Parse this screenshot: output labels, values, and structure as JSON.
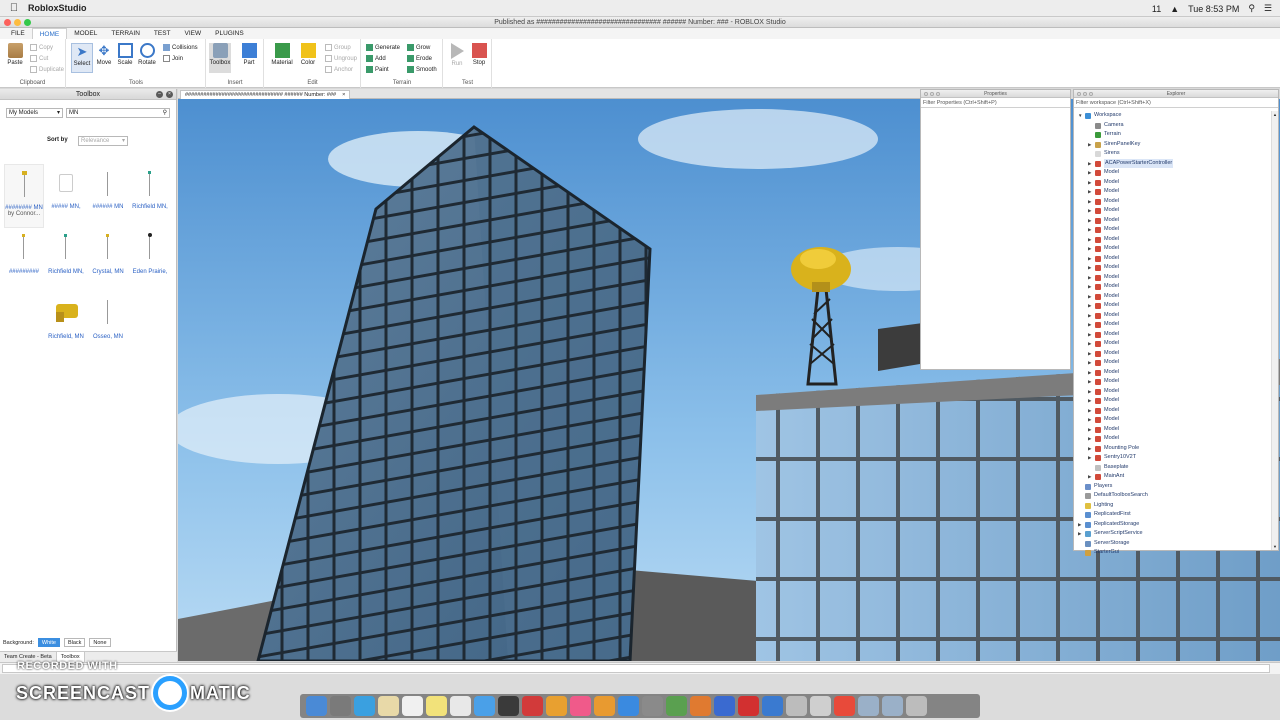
{
  "menubar": {
    "app_name": "RobloxStudio",
    "tray": [
      "11",
      "Tue 8:53 PM"
    ]
  },
  "window": {
    "title": "Published as ################################ ###### Number: ### - ROBLOX Studio"
  },
  "ribbon_tabs": [
    "FILE",
    "HOME",
    "MODEL",
    "TERRAIN",
    "TEST",
    "VIEW",
    "PLUGINS"
  ],
  "ribbon": {
    "clipboard": {
      "title": "Clipboard",
      "paste": "Paste",
      "copy": "Copy",
      "cut": "Cut",
      "duplicate": "Duplicate"
    },
    "tools": {
      "title": "Tools",
      "select": "Select",
      "move": "Move",
      "scale": "Scale",
      "rotate": "Rotate",
      "collisions": "Collisions",
      "join": "Join"
    },
    "insert": {
      "title": "Insert",
      "toolbox": "Toolbox",
      "part": "Part"
    },
    "edit": {
      "title": "Edit",
      "material": "Material",
      "color": "Color",
      "group": "Group",
      "ungroup": "Ungroup",
      "anchor": "Anchor"
    },
    "terrain": {
      "title": "Terrain",
      "generate": "Generate",
      "grow": "Grow",
      "add": "Add",
      "erode": "Erode",
      "paint": "Paint",
      "smooth": "Smooth"
    },
    "test": {
      "title": "Test",
      "run": "Run",
      "stop": "Stop"
    }
  },
  "toolbox": {
    "title": "Toolbox",
    "category": "My Models",
    "search_value": "MN",
    "sort_label": "Sort by",
    "sort_value": "Relevance",
    "items": [
      {
        "label": "######## MN",
        "sub": "by Connor..."
      },
      {
        "label": "##### MN,"
      },
      {
        "label": "###### MN"
      },
      {
        "label": "Richfield MN,"
      },
      {
        "label": "#########"
      },
      {
        "label": "Richfield MN,"
      },
      {
        "label": "Crystal, MN"
      },
      {
        "label": "Eden Prairie,"
      },
      {
        "label": "Richfield, MN"
      },
      {
        "label": "Osseo, MN"
      }
    ],
    "background_label": "Background:",
    "bg_white": "White",
    "bg_black": "Black",
    "bg_none": "None",
    "bottom_tabs": [
      "Team Create - Beta",
      "Toolbox"
    ]
  },
  "document_tab": "################################ ###### Number: ###",
  "properties": {
    "title": "Properties",
    "filter_placeholder": "Filter Properties (Ctrl+Shift+P)"
  },
  "explorer": {
    "title": "Explorer",
    "filter_placeholder": "Filter workspace (Ctrl+Shift+X)",
    "tree": [
      {
        "label": "Workspace",
        "depth": 0,
        "arrow": "open",
        "color": "#3c8fd6"
      },
      {
        "label": "Camera",
        "depth": 1,
        "arrow": "",
        "color": "#8a8a8a"
      },
      {
        "label": "Terrain",
        "depth": 1,
        "arrow": "",
        "color": "#3a9a3a"
      },
      {
        "label": "SirenPanelKey",
        "depth": 1,
        "arrow": "closed",
        "color": "#c9a24a"
      },
      {
        "label": "Sirens",
        "depth": 1,
        "arrow": "",
        "color": "#d8d8d8"
      },
      {
        "label": "ACAPowerStarterController",
        "depth": 1,
        "arrow": "closed",
        "color": "#d24a3a",
        "selected": true
      },
      {
        "label": "Model",
        "depth": 1,
        "arrow": "closed",
        "color": "#d24a3a"
      },
      {
        "label": "Model",
        "depth": 1,
        "arrow": "closed",
        "color": "#d24a3a"
      },
      {
        "label": "Model",
        "depth": 1,
        "arrow": "closed",
        "color": "#d24a3a"
      },
      {
        "label": "Model",
        "depth": 1,
        "arrow": "closed",
        "color": "#d24a3a"
      },
      {
        "label": "Model",
        "depth": 1,
        "arrow": "closed",
        "color": "#d24a3a"
      },
      {
        "label": "Model",
        "depth": 1,
        "arrow": "closed",
        "color": "#d24a3a"
      },
      {
        "label": "Model",
        "depth": 1,
        "arrow": "closed",
        "color": "#d24a3a"
      },
      {
        "label": "Model",
        "depth": 1,
        "arrow": "closed",
        "color": "#d24a3a"
      },
      {
        "label": "Model",
        "depth": 1,
        "arrow": "closed",
        "color": "#d24a3a"
      },
      {
        "label": "Model",
        "depth": 1,
        "arrow": "closed",
        "color": "#d24a3a"
      },
      {
        "label": "Model",
        "depth": 1,
        "arrow": "closed",
        "color": "#d24a3a"
      },
      {
        "label": "Model",
        "depth": 1,
        "arrow": "closed",
        "color": "#d24a3a"
      },
      {
        "label": "Model",
        "depth": 1,
        "arrow": "closed",
        "color": "#d24a3a"
      },
      {
        "label": "Model",
        "depth": 1,
        "arrow": "closed",
        "color": "#d24a3a"
      },
      {
        "label": "Model",
        "depth": 1,
        "arrow": "closed",
        "color": "#d24a3a"
      },
      {
        "label": "Model",
        "depth": 1,
        "arrow": "closed",
        "color": "#d24a3a"
      },
      {
        "label": "Model",
        "depth": 1,
        "arrow": "closed",
        "color": "#d24a3a"
      },
      {
        "label": "Model",
        "depth": 1,
        "arrow": "closed",
        "color": "#d24a3a"
      },
      {
        "label": "Model",
        "depth": 1,
        "arrow": "closed",
        "color": "#d24a3a"
      },
      {
        "label": "Model",
        "depth": 1,
        "arrow": "closed",
        "color": "#d24a3a"
      },
      {
        "label": "Model",
        "depth": 1,
        "arrow": "closed",
        "color": "#d24a3a"
      },
      {
        "label": "Model",
        "depth": 1,
        "arrow": "closed",
        "color": "#d24a3a"
      },
      {
        "label": "Model",
        "depth": 1,
        "arrow": "closed",
        "color": "#d24a3a"
      },
      {
        "label": "Model",
        "depth": 1,
        "arrow": "closed",
        "color": "#d24a3a"
      },
      {
        "label": "Model",
        "depth": 1,
        "arrow": "closed",
        "color": "#d24a3a"
      },
      {
        "label": "Model",
        "depth": 1,
        "arrow": "closed",
        "color": "#d24a3a"
      },
      {
        "label": "Model",
        "depth": 1,
        "arrow": "closed",
        "color": "#d24a3a"
      },
      {
        "label": "Model",
        "depth": 1,
        "arrow": "closed",
        "color": "#d24a3a"
      },
      {
        "label": "Model",
        "depth": 1,
        "arrow": "closed",
        "color": "#d24a3a"
      },
      {
        "label": "Mounting Pole",
        "depth": 1,
        "arrow": "closed",
        "color": "#d24a3a"
      },
      {
        "label": "Sentry10V2T",
        "depth": 1,
        "arrow": "closed",
        "color": "#d24a3a"
      },
      {
        "label": "Baseplate",
        "depth": 1,
        "arrow": "",
        "color": "#bfbfbf"
      },
      {
        "label": "MainAnt",
        "depth": 1,
        "arrow": "closed",
        "color": "#d24a3a"
      },
      {
        "label": "Players",
        "depth": 0,
        "arrow": "",
        "color": "#6b8fc9"
      },
      {
        "label": "DefaultToolboxSearch",
        "depth": 0,
        "arrow": "",
        "color": "#9a9a9a"
      },
      {
        "label": "Lighting",
        "depth": 0,
        "arrow": "",
        "color": "#e0c040"
      },
      {
        "label": "ReplicatedFirst",
        "depth": 0,
        "arrow": "",
        "color": "#5a8fd0"
      },
      {
        "label": "ReplicatedStorage",
        "depth": 0,
        "arrow": "closed",
        "color": "#5a8fd0"
      },
      {
        "label": "ServerScriptService",
        "depth": 0,
        "arrow": "closed",
        "color": "#5aa0d0"
      },
      {
        "label": "ServerStorage",
        "depth": 0,
        "arrow": "",
        "color": "#6a90c0"
      },
      {
        "label": "StarterGui",
        "depth": 0,
        "arrow": "",
        "color": "#d0a040"
      }
    ]
  },
  "watermark": {
    "line1": "RECORDED WITH",
    "line2a": "SCREENCAST",
    "line2b": "MATIC"
  },
  "colors": {
    "accent": "#2a6fc9",
    "sky": "#7fb8e6",
    "building": "#3b4d5e"
  }
}
